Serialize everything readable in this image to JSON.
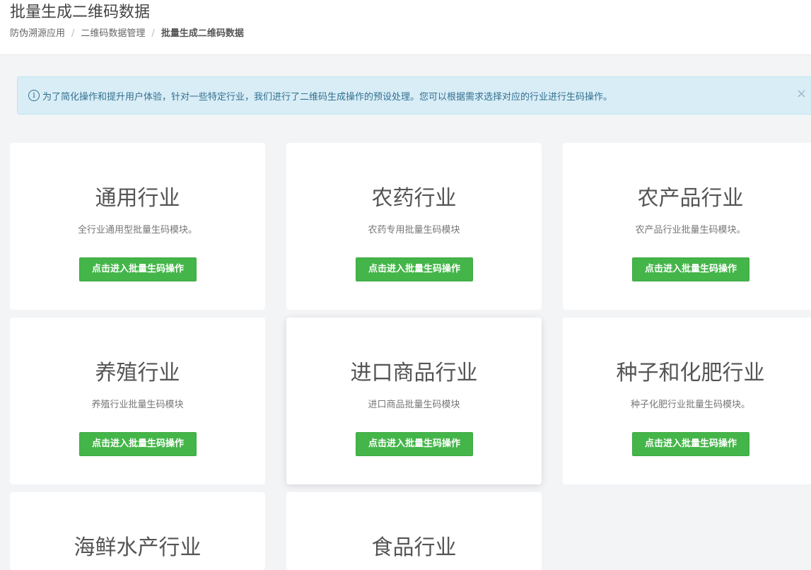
{
  "header": {
    "title": "批量生成二维码数据",
    "breadcrumb": [
      "防伪溯源应用",
      "二维码数据管理",
      "批量生成二维码数据"
    ],
    "separator": "/"
  },
  "alert": {
    "icon": "info-icon",
    "icon_glyph": "i",
    "text": "为了简化操作和提升用户体验，针对一些特定行业，我们进行了二维码生成操作的预设处理。您可以根据需求选择对应的行业进行生码操作。",
    "close_glyph": "×"
  },
  "colors": {
    "button": "#44b549",
    "alert_bg": "#d9edf7",
    "alert_text": "#31708f"
  },
  "cards": [
    {
      "title": "通用行业",
      "desc": "全行业通用型批量生码模块。",
      "button": "点击进入批量生码操作"
    },
    {
      "title": "农药行业",
      "desc": "农药专用批量生码模块",
      "button": "点击进入批量生码操作"
    },
    {
      "title": "农产品行业",
      "desc": "农产品行业批量生码模块。",
      "button": "点击进入批量生码操作"
    },
    {
      "title": "养殖行业",
      "desc": "养殖行业批量生码模块",
      "button": "点击进入批量生码操作"
    },
    {
      "title": "进口商品行业",
      "desc": "进口商品批量生码模块",
      "button": "点击进入批量生码操作"
    },
    {
      "title": "种子和化肥行业",
      "desc": "种子化肥行业批量生码模块。",
      "button": "点击进入批量生码操作"
    },
    {
      "title": "海鲜水产行业"
    },
    {
      "title": "食品行业"
    }
  ]
}
